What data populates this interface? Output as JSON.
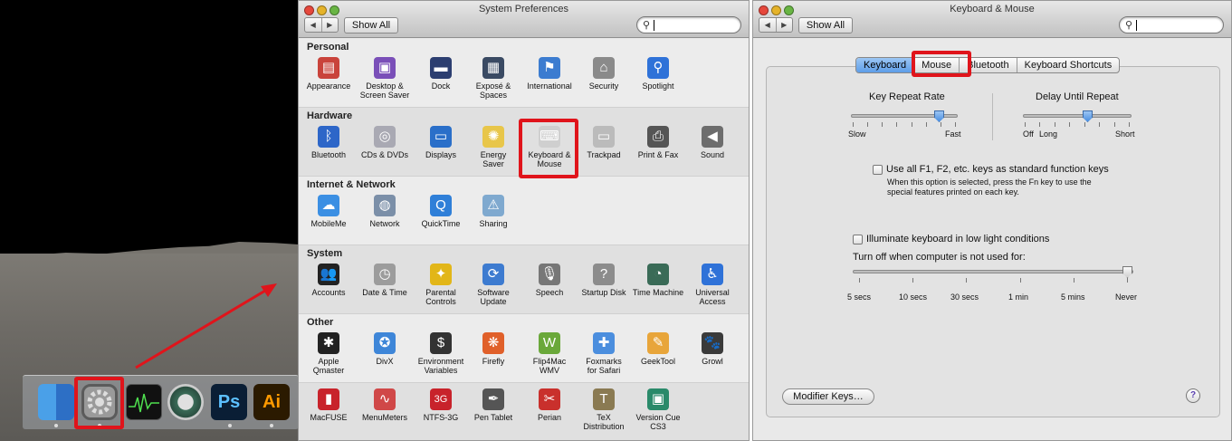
{
  "dock": {
    "items": [
      {
        "name": "Finder",
        "icon": "finder-icon"
      },
      {
        "name": "System Preferences",
        "icon": "gear-icon"
      },
      {
        "name": "Activity Monitor",
        "icon": "activity-monitor-icon"
      },
      {
        "name": "Time Machine",
        "icon": "time-machine-icon"
      },
      {
        "name": "Photoshop",
        "icon": "photoshop-icon",
        "text": "Ps"
      },
      {
        "name": "Illustrator",
        "icon": "illustrator-icon",
        "text": "Ai"
      }
    ],
    "highlight_color": "#e0141b"
  },
  "sysprefs": {
    "title": "System Preferences",
    "show_all": "Show All",
    "search_placeholder": "",
    "sections": [
      {
        "title": "Personal",
        "panes": [
          {
            "label": "Appearance",
            "icon": "appearance-icon",
            "color": "#c9433b",
            "glyph": "▤"
          },
          {
            "label": "Desktop &\nScreen Saver",
            "icon": "desktop-icon",
            "color": "#7a4fb8",
            "glyph": "▣"
          },
          {
            "label": "Dock",
            "icon": "dock-icon",
            "color": "#2c3e70",
            "glyph": "▬"
          },
          {
            "label": "Exposé &\nSpaces",
            "icon": "expose-icon",
            "color": "#3a4a63",
            "glyph": "▦"
          },
          {
            "label": "International",
            "icon": "flag-icon",
            "color": "#3c7cd0",
            "glyph": "⚑"
          },
          {
            "label": "Security",
            "icon": "house-lock-icon",
            "color": "#8a8a8a",
            "glyph": "⌂"
          },
          {
            "label": "Spotlight",
            "icon": "spotlight-icon",
            "color": "#2f72d8",
            "glyph": "⚲"
          }
        ]
      },
      {
        "title": "Hardware",
        "panes": [
          {
            "label": "Bluetooth",
            "icon": "bluetooth-icon",
            "color": "#2d66c8",
            "glyph": "ᛒ"
          },
          {
            "label": "CDs & DVDs",
            "icon": "disc-icon",
            "color": "#a9a9b3",
            "glyph": "◎"
          },
          {
            "label": "Displays",
            "icon": "display-icon",
            "color": "#2a6fc9",
            "glyph": "▭"
          },
          {
            "label": "Energy\nSaver",
            "icon": "lightbulb-icon",
            "color": "#e8c64a",
            "glyph": "✺"
          },
          {
            "label": "Keyboard &\nMouse",
            "icon": "keyboard-mouse-icon",
            "color": "#cfcfcf",
            "glyph": "⌨"
          },
          {
            "label": "Trackpad",
            "icon": "trackpad-icon",
            "color": "#bbbbbb",
            "glyph": "▭"
          },
          {
            "label": "Print & Fax",
            "icon": "printer-icon",
            "color": "#555555",
            "glyph": "⎙"
          },
          {
            "label": "Sound",
            "icon": "speaker-icon",
            "color": "#6d6d6d",
            "glyph": "◀"
          }
        ]
      },
      {
        "title": "Internet & Network",
        "panes": [
          {
            "label": "MobileMe",
            "icon": "cloud-icon",
            "color": "#3b8fe3",
            "glyph": "☁"
          },
          {
            "label": "Network",
            "icon": "globe-icon",
            "color": "#7b8fa8",
            "glyph": "◍"
          },
          {
            "label": "QuickTime",
            "icon": "quicktime-icon",
            "color": "#2f7fd8",
            "glyph": "Q"
          },
          {
            "label": "Sharing",
            "icon": "sharing-folder-icon",
            "color": "#7fa9cf",
            "glyph": "⚠"
          }
        ]
      },
      {
        "title": "System",
        "panes": [
          {
            "label": "Accounts",
            "icon": "accounts-icon",
            "color": "#222222",
            "glyph": "👥"
          },
          {
            "label": "Date & Time",
            "icon": "clock-icon",
            "color": "#9c9c9c",
            "glyph": "◷"
          },
          {
            "label": "Parental\nControls",
            "icon": "parental-controls-icon",
            "color": "#e2b618",
            "glyph": "✦"
          },
          {
            "label": "Software\nUpdate",
            "icon": "software-update-icon",
            "color": "#3d7bd0",
            "glyph": "⟳"
          },
          {
            "label": "Speech",
            "icon": "microphone-icon",
            "color": "#777777",
            "glyph": "🎙"
          },
          {
            "label": "Startup Disk",
            "icon": "disk-icon",
            "color": "#8c8c8c",
            "glyph": "?"
          },
          {
            "label": "Time Machine",
            "icon": "time-machine-icon",
            "color": "#3a6b57",
            "glyph": "◔"
          },
          {
            "label": "Universal\nAccess",
            "icon": "universal-access-icon",
            "color": "#2f72d8",
            "glyph": "♿"
          }
        ]
      },
      {
        "title": "Other",
        "panes": [
          {
            "label": "Apple\nQmaster",
            "icon": "qmaster-icon",
            "color": "#222222",
            "glyph": "✱"
          },
          {
            "label": "DivX",
            "icon": "divx-icon",
            "color": "#3e86d8",
            "glyph": "✪"
          },
          {
            "label": "Environment\nVariables",
            "icon": "env-icon",
            "color": "#333333",
            "glyph": "$"
          },
          {
            "label": "Firefly",
            "icon": "firefly-icon",
            "color": "#e0602a",
            "glyph": "❋"
          },
          {
            "label": "Flip4Mac\nWMV",
            "icon": "flip4mac-icon",
            "color": "#6aa83a",
            "glyph": "W"
          },
          {
            "label": "Foxmarks\nfor Safari",
            "icon": "foxmarks-icon",
            "color": "#4b8ede",
            "glyph": "✚"
          },
          {
            "label": "GeekTool",
            "icon": "geektool-icon",
            "color": "#e8a53a",
            "glyph": "✎"
          },
          {
            "label": "Growl",
            "icon": "growl-icon",
            "color": "#3a3a3a",
            "glyph": "🐾"
          }
        ]
      },
      {
        "title": "",
        "panes": [
          {
            "label": "MacFUSE",
            "icon": "macfuse-icon",
            "color": "#c8232b",
            "glyph": "▮"
          },
          {
            "label": "MenuMeters",
            "icon": "menumeters-icon",
            "color": "#d04848",
            "glyph": "∿"
          },
          {
            "label": "NTFS-3G",
            "icon": "ntfs3g-icon",
            "color": "#c8232b",
            "glyph": "3G"
          },
          {
            "label": "Pen Tablet",
            "icon": "pen-tablet-icon",
            "color": "#555555",
            "glyph": "✒"
          },
          {
            "label": "Perian",
            "icon": "perian-icon",
            "color": "#c9302c",
            "glyph": "✂"
          },
          {
            "label": "TeX\nDistribution",
            "icon": "tex-icon",
            "color": "#8a7a52",
            "glyph": "T"
          },
          {
            "label": "Version Cue\nCS3",
            "icon": "version-cue-icon",
            "color": "#2a8a6a",
            "glyph": "▣"
          }
        ]
      }
    ]
  },
  "keyboard_mouse": {
    "title": "Keyboard & Mouse",
    "show_all": "Show All",
    "tabs": [
      "Keyboard",
      "Mouse",
      "Bluetooth",
      "Keyboard Shortcuts"
    ],
    "active_tab": "Keyboard",
    "key_repeat": {
      "label": "Key Repeat Rate",
      "min_label": "Slow",
      "max_label": "Fast",
      "value": 0.83
    },
    "delay_repeat": {
      "label": "Delay Until Repeat",
      "min_label": "Off",
      "mid_label": "Long",
      "max_label": "Short",
      "value": 0.6
    },
    "fn_keys": {
      "label": "Use all F1, F2, etc. keys as standard function keys",
      "help_line1": "When this option is selected, press the Fn key to use the",
      "help_line2": "special features printed on each key.",
      "checked": false
    },
    "illuminate": {
      "label": "Illuminate keyboard in low light conditions",
      "checked": false
    },
    "turn_off": {
      "label": "Turn off when computer is not used for:",
      "ticks": [
        "5 secs",
        "10 secs",
        "30 secs",
        "1 min",
        "5 mins",
        "Never"
      ],
      "value": "Never"
    },
    "modifier_keys": "Modifier Keys…",
    "help": "?"
  }
}
